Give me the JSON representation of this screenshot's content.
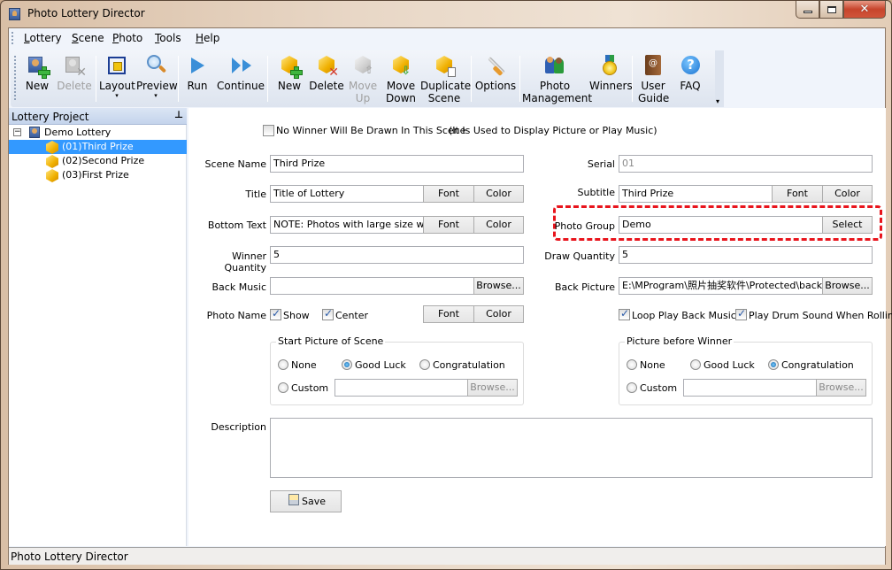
{
  "window": {
    "title": "Photo Lottery Director",
    "controls": [
      "minimize",
      "maximize",
      "close"
    ]
  },
  "menu": [
    {
      "label": "Lottery",
      "mnemonic": "L",
      "rest": "ottery"
    },
    {
      "label": "Scene",
      "mnemonic": "S",
      "rest": "cene"
    },
    {
      "label": "Photo",
      "mnemonic": "P",
      "rest": "hoto"
    },
    {
      "label": "Tools",
      "mnemonic": "T",
      "rest": "ools"
    },
    {
      "label": "Help",
      "mnemonic": "H",
      "rest": "elp"
    }
  ],
  "toolbar": {
    "buttons": [
      {
        "id": "new-lottery",
        "line1": "New",
        "line2": "",
        "icon": "person-add-icon",
        "enabled": true
      },
      {
        "id": "delete-lottery",
        "line1": "Delete",
        "line2": "",
        "icon": "person-delete-icon",
        "enabled": false
      },
      {
        "id": "layout",
        "line1": "Layout",
        "line2": "▾",
        "icon": "layout-icon",
        "enabled": true
      },
      {
        "id": "preview",
        "line1": "Preview",
        "line2": "▾",
        "icon": "magnifier-icon",
        "enabled": true
      },
      {
        "id": "run",
        "line1": "Run",
        "line2": "",
        "icon": "play-icon",
        "enabled": true
      },
      {
        "id": "continue",
        "line1": "Continue",
        "line2": "",
        "icon": "continue-icon",
        "enabled": true
      },
      {
        "id": "new-scene",
        "line1": "New",
        "line2": "",
        "icon": "cube-add-icon",
        "enabled": true
      },
      {
        "id": "delete-scene",
        "line1": "Delete",
        "line2": "",
        "icon": "cube-delete-icon",
        "enabled": true
      },
      {
        "id": "move-up",
        "line1": "Move",
        "line2": "Up",
        "icon": "cube-up-icon",
        "enabled": false
      },
      {
        "id": "move-down",
        "line1": "Move",
        "line2": "Down",
        "icon": "cube-down-icon",
        "enabled": true
      },
      {
        "id": "duplicate-scene",
        "line1": "Duplicate",
        "line2": "Scene",
        "icon": "cube-duplicate-icon",
        "enabled": true
      },
      {
        "id": "options",
        "line1": "Options",
        "line2": "",
        "icon": "wrench-icon",
        "enabled": true
      },
      {
        "id": "photo-management",
        "line1": "Photo",
        "line2": "Management",
        "icon": "people-icon",
        "enabled": true
      },
      {
        "id": "winners",
        "line1": "Winners",
        "line2": "",
        "icon": "medal-icon",
        "enabled": true
      },
      {
        "id": "user-guide",
        "line1": "User",
        "line2": "Guide",
        "icon": "book-icon",
        "enabled": true
      },
      {
        "id": "faq",
        "line1": "FAQ",
        "line2": "",
        "icon": "help-icon",
        "enabled": true
      }
    ]
  },
  "left_panel": {
    "title": "Lottery Project",
    "pin_glyph": "ᵽ",
    "tree": {
      "root": {
        "label": "Demo Lottery",
        "expander": "−"
      },
      "items": [
        {
          "label": "(01)Third Prize",
          "selected": true
        },
        {
          "label": "(02)Second Prize",
          "selected": false
        },
        {
          "label": "(03)First Prize",
          "selected": false
        }
      ]
    }
  },
  "form": {
    "no_winner": {
      "checked": false,
      "label": "No Winner Will Be Drawn In This Scene",
      "note": "(It Is Used to Display Picture or Play Music)"
    },
    "scene_name": {
      "label": "Scene Name",
      "value": "Third Prize"
    },
    "serial": {
      "label": "Serial",
      "value": "01"
    },
    "title": {
      "label": "Title",
      "value": "Title of Lottery"
    },
    "subtitle": {
      "label": "Subtitle",
      "value": "Third Prize"
    },
    "bottom_text": {
      "label": "Bottom Text",
      "value": "NOTE: Photos with large size will ma"
    },
    "photo_group": {
      "label": "Photo Group",
      "value": "Demo",
      "button": "Select",
      "highlight_color": "#e8141c"
    },
    "winner_quantity": {
      "label": "Winner Quantity",
      "value": "5"
    },
    "draw_quantity": {
      "label": "Draw Quantity",
      "value": "5"
    },
    "back_music": {
      "label": "Back Music",
      "value": "",
      "button": "Browse..."
    },
    "back_picture": {
      "label": "Back Picture",
      "value": "E:\\MProgram\\照片抽奖软件\\Protected\\back.jp",
      "button": "Browse..."
    },
    "photo_name": {
      "label": "Photo Name",
      "show": {
        "label": "Show",
        "checked": true
      },
      "center": {
        "label": "Center",
        "checked": true
      }
    },
    "loop_music": {
      "label": "Loop Play Back Music",
      "checked": true
    },
    "drum_sound": {
      "label": "Play Drum Sound When Rolling P",
      "checked": true
    },
    "font_label": "Font",
    "color_label": "Color",
    "start_picture": {
      "title": "Start Picture of Scene",
      "options": [
        {
          "label": "None",
          "selected": false
        },
        {
          "label": "Good Luck",
          "selected": true
        },
        {
          "label": "Congratulation",
          "selected": false
        },
        {
          "label": "Custom",
          "selected": false
        }
      ],
      "custom_value": "",
      "browse": "Browse..."
    },
    "picture_before_winner": {
      "title": "Picture before Winner",
      "options": [
        {
          "label": "None",
          "selected": false
        },
        {
          "label": "Good Luck",
          "selected": false
        },
        {
          "label": "Congratulation",
          "selected": true
        },
        {
          "label": "Custom",
          "selected": false
        }
      ],
      "custom_value": "",
      "browse": "Browse..."
    },
    "description": {
      "label": "Description",
      "value": ""
    },
    "save_label": "Save"
  },
  "statusbar": {
    "text": "Photo Lottery Director"
  },
  "colors": {
    "selection": "#3399ff",
    "highlight": "#e8141c",
    "toolbar_bg": "#dde4ef"
  }
}
